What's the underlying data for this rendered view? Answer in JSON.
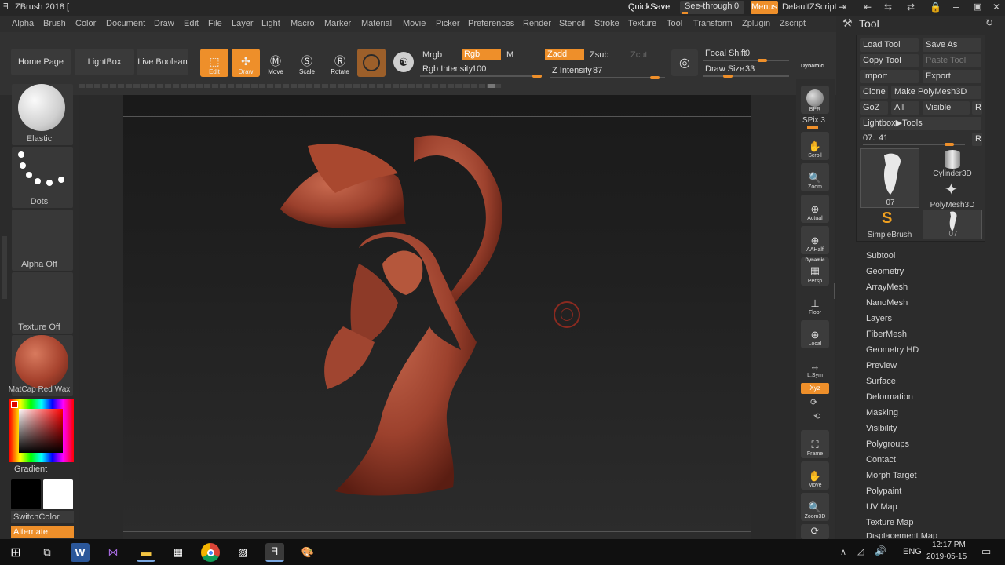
{
  "app": {
    "title": "ZBrush 2018 [",
    "quicksave": "QuickSave",
    "see_through_label": "See-through",
    "see_through_value": "0",
    "menus": "Menus",
    "zscript": "DefaultZScript"
  },
  "menubar": [
    "Alpha",
    "Brush",
    "Color",
    "Document",
    "Draw",
    "Edit",
    "File",
    "Layer",
    "Light",
    "Macro",
    "Marker",
    "Material",
    "Movie",
    "Picker",
    "Preferences",
    "Render",
    "Stencil",
    "Stroke",
    "Texture",
    "Tool",
    "Transform",
    "Zplugin",
    "Zscript"
  ],
  "toolbar": {
    "home_page": "Home Page",
    "lightbox": "LightBox",
    "live_boolean": "Live Boolean",
    "edit": "Edit",
    "draw": "Draw",
    "move": "Move",
    "scale": "Scale",
    "rotate": "Rotate",
    "mrgb": "Mrgb",
    "rgb": "Rgb",
    "m": "M",
    "zadd": "Zadd",
    "zsub": "Zsub",
    "zcut": "Zcut",
    "rgb_intensity_label": "Rgb Intensity",
    "rgb_intensity_value": "100",
    "z_intensity_label": "Z Intensity",
    "z_intensity_value": "87",
    "focal_shift_label": "Focal Shift",
    "focal_shift_value": "0",
    "draw_size_label": "Draw Size",
    "draw_size_value": "33",
    "dynamic": "Dynamic"
  },
  "left_shelf": {
    "brush": "Elastic",
    "stroke": "Dots",
    "alpha": "Alpha Off",
    "texture": "Texture Off",
    "material": "MatCap Red Wax",
    "gradient": "Gradient",
    "switch_color": "SwitchColor",
    "alternate": "Alternate"
  },
  "right_shelf": {
    "bpr": "BPR",
    "spix_label": "SPix",
    "spix_value": "3",
    "scroll": "Scroll",
    "zoom": "Zoom",
    "actual": "Actual",
    "aahalf": "AAHalf",
    "dynamic": "Dynamic",
    "persp": "Persp",
    "floor": "Floor",
    "local": "Local",
    "lsym": "L.Sym",
    "xyz": "Xyz",
    "frame": "Frame",
    "move": "Move",
    "zoom3d": "Zoom3D"
  },
  "tool_panel": {
    "title": "Tool",
    "load_tool": "Load Tool",
    "save_as": "Save As",
    "copy_tool": "Copy Tool",
    "paste_tool": "Paste Tool",
    "import": "Import",
    "export": "Export",
    "clone": "Clone",
    "make_polymesh": "Make PolyMesh3D",
    "goz": "GoZ",
    "all": "All",
    "visible": "Visible",
    "r": "R",
    "lightbox_tools": "Lightbox▶Tools",
    "tool_slider_label": "07.",
    "tool_slider_value": "41",
    "thumbs": [
      "07",
      "Cylinder3D",
      "PolyMesh3D",
      "SimpleBrush",
      "07"
    ],
    "sections": [
      "Subtool",
      "Geometry",
      "ArrayMesh",
      "NanoMesh",
      "Layers",
      "FiberMesh",
      "Geometry HD",
      "Preview",
      "Surface",
      "Deformation",
      "Masking",
      "Visibility",
      "Polygroups",
      "Contact",
      "Morph Target",
      "Polypaint",
      "UV Map",
      "Texture Map",
      "Displacement Map"
    ]
  },
  "taskbar": {
    "lang": "ENG",
    "time": "12:17 PM",
    "date": "2019-05-15"
  }
}
